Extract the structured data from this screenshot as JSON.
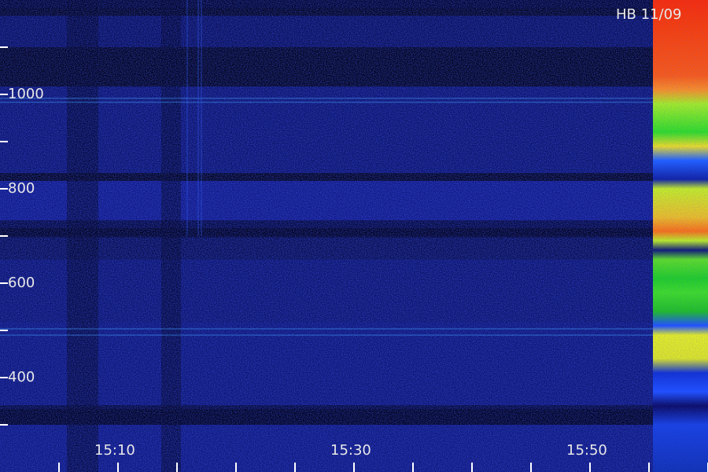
{
  "station_label": "HB  11/09",
  "y_axis": {
    "labels": [
      "1000",
      "800",
      "600",
      "400"
    ],
    "tick_values": [
      1100,
      1000,
      900,
      800,
      700,
      600,
      500,
      400,
      300
    ]
  },
  "x_axis": {
    "labels": [
      "15:10",
      "15:30",
      "15:50"
    ]
  },
  "colors": {
    "background": "#000010",
    "noise_low": "#0a0a6e",
    "noise_high": "#2a3cff",
    "signal_green": "#22e81a",
    "signal_yellow": "#e8f010",
    "signal_red": "#ff2a00"
  }
}
